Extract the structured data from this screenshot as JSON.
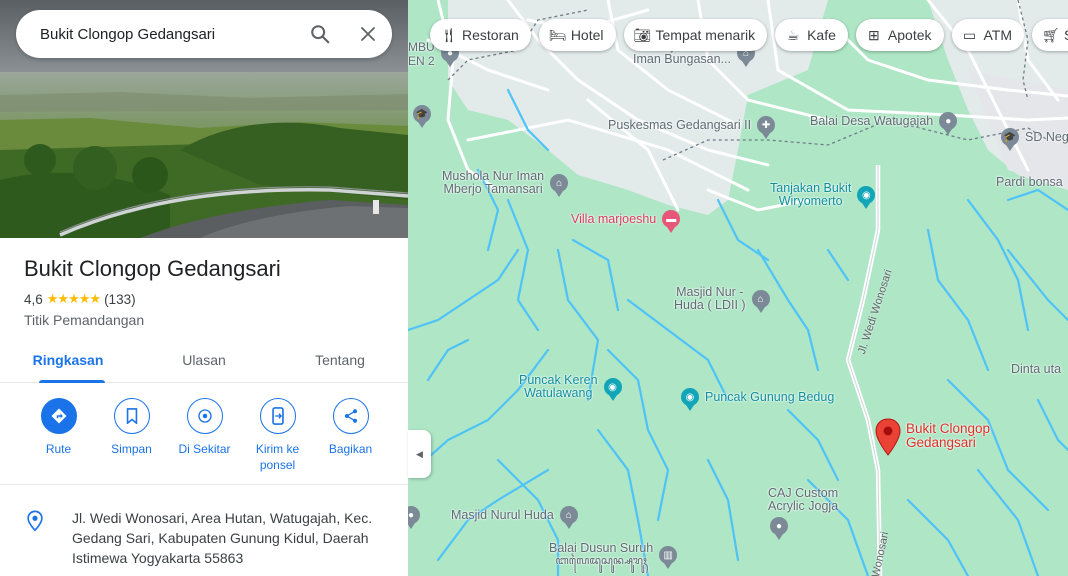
{
  "search": {
    "query": "Bukit Clongop Gedangsari"
  },
  "place": {
    "name": "Bukit Clongop Gedangsari",
    "rating": "4,6",
    "reviews": "(133)",
    "category": "Titik Pemandangan",
    "address": "Jl. Wedi Wonosari, Area Hutan, Watugajah, Kec. Gedang Sari, Kabupaten Gunung Kidul, Daerah Istimewa Yogyakarta 55863"
  },
  "tabs": [
    "Ringkasan",
    "Ulasan",
    "Tentang"
  ],
  "actions": [
    "Rute",
    "Simpan",
    "Di Sekitar",
    "Kirim ke ponsel",
    "Bagikan"
  ],
  "chips": [
    {
      "label": "Restoran",
      "icon": "fork-knife-icon"
    },
    {
      "label": "Hotel",
      "icon": "bed-icon"
    },
    {
      "label": "Tempat menarik",
      "icon": "camera-icon"
    },
    {
      "label": "Kafe",
      "icon": "coffee-icon"
    },
    {
      "label": "Apotek",
      "icon": "pharmacy-icon"
    },
    {
      "label": "ATM",
      "icon": "atm-icon"
    },
    {
      "label": "Su",
      "icon": "cart-icon"
    }
  ],
  "map_labels": {
    "masjid_nurul_iman": "Masjid Nurul\nIman Bungasan...",
    "puskesmas": "Puskesmas Gedangsari II",
    "balai_desa": "Balai Desa Watugajah",
    "sd_neg": "SD Neg",
    "mushola": "Mushola Nur Iman\nMberjo Tamansari",
    "tanjakan": "Tanjakan Bukit\nWiryomerto",
    "pardi": "Pardi bonsa",
    "villa": "Villa marjoeshu",
    "masjid_nur_huda": "Masjid Nur -\nHuda ( LDII )",
    "puncak_keren": "Puncak Keren\nWatulawang",
    "puncak_gunung": "Puncak Gunung Bedug",
    "dinta": "Dinta uta",
    "bukit": "Bukit Clongop\nGedangsari",
    "caj": "CAJ Custom\nAcrylic Jogja",
    "masjid_nurul_huda": "Masjid Nurul Huda",
    "balai_dusun": "Balai Dusun Suruh",
    "balai_dusun_jv": "ꦧꦭꦻꦢꦸꦱꦸꦤ꧀ꦱꦸꦫꦸꦃ",
    "en2": "EN 2",
    "mbu": "MBU",
    "road_wedi": "Jl. Wedi Wonosari",
    "road_wonosari": "Wonosari"
  },
  "colors": {
    "accent": "#1a73e8",
    "marker": "#ea4335",
    "star": "#fbbc04"
  }
}
